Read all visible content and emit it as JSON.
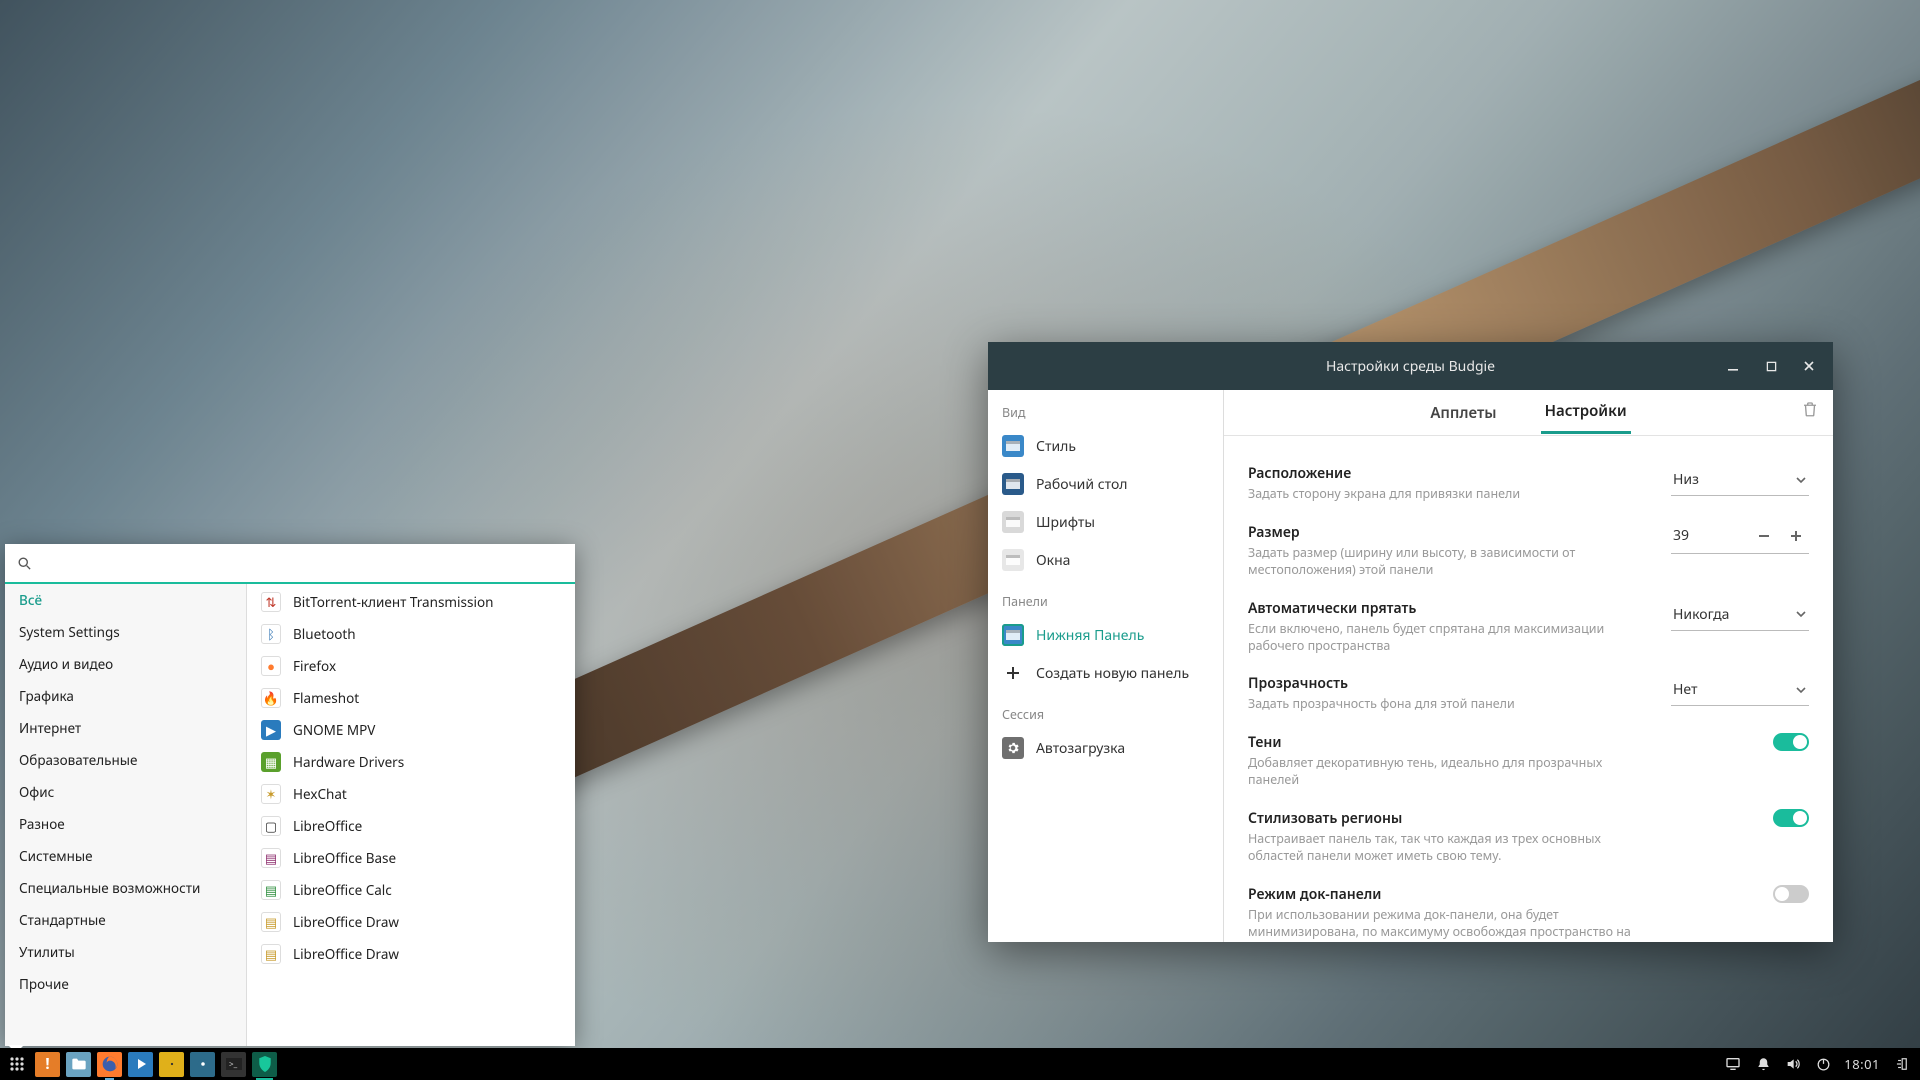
{
  "taskbar": {
    "clock": "18:01",
    "apps": [
      {
        "name": "menu-icon",
        "bg": "#000",
        "glyph": "grid",
        "running": false
      },
      {
        "name": "updates-icon",
        "bg": "#e57d28",
        "glyph": "!",
        "running": false
      },
      {
        "name": "files-icon",
        "bg": "#6aa3c1",
        "glyph": "folder",
        "running": false
      },
      {
        "name": "firefox-icon",
        "bg": "#ff7b2e",
        "glyph": "fx",
        "running": true
      },
      {
        "name": "video-icon",
        "bg": "#2a7bbd",
        "glyph": "play",
        "running": false
      },
      {
        "name": "music-icon",
        "bg": "#e0b01a",
        "glyph": "music",
        "running": false
      },
      {
        "name": "settings-icon",
        "bg": "#2d6b8a",
        "glyph": "gear",
        "running": false
      },
      {
        "name": "terminal-icon",
        "bg": "#333",
        "glyph": "term",
        "running": false
      },
      {
        "name": "shield-icon",
        "bg": "#0e5d48",
        "glyph": "shield",
        "running": false,
        "active": true
      }
    ]
  },
  "menu": {
    "search_placeholder": "",
    "categories": [
      "Всё",
      "System Settings",
      "Аудио и видео",
      "Графика",
      "Интернет",
      "Образовательные",
      "Офис",
      "Разное",
      "Системные",
      "Специальные возможности",
      "Стандартные",
      "Утилиты",
      "Прочие"
    ],
    "active_category": 0,
    "apps": [
      {
        "label": "BitTorrent-клиент Transmission",
        "bg": "#fff",
        "fg": "#c0392b",
        "glyph": "⇅"
      },
      {
        "label": "Bluetooth",
        "bg": "#fff",
        "fg": "#2a6fb0",
        "glyph": "ᛒ"
      },
      {
        "label": "Firefox",
        "bg": "#fff",
        "fg": "#ff7b2e",
        "glyph": "●"
      },
      {
        "label": "Flameshot",
        "bg": "#fff",
        "fg": "#7c3aed",
        "glyph": "🔥"
      },
      {
        "label": "GNOME MPV",
        "bg": "#2a7bbd",
        "fg": "#fff",
        "glyph": "▶"
      },
      {
        "label": "Hardware Drivers",
        "bg": "#5aa02c",
        "fg": "#fff",
        "glyph": "▦"
      },
      {
        "label": "HexChat",
        "bg": "#fff",
        "fg": "#c79a2a",
        "glyph": "✶"
      },
      {
        "label": "LibreOffice",
        "bg": "#fff",
        "fg": "#333",
        "glyph": "▢"
      },
      {
        "label": "LibreOffice Base",
        "bg": "#fff",
        "fg": "#8e2e6e",
        "glyph": "▤"
      },
      {
        "label": "LibreOffice Calc",
        "bg": "#fff",
        "fg": "#2e8e3e",
        "glyph": "▤"
      },
      {
        "label": "LibreOffice Draw",
        "bg": "#fff",
        "fg": "#c79a2a",
        "glyph": "▤"
      },
      {
        "label": "LibreOffice Draw",
        "bg": "#fff",
        "fg": "#c79a2a",
        "glyph": "▤"
      }
    ]
  },
  "settings_window": {
    "title": "Настройки среды Budgie",
    "sidebar": {
      "section_view": "Вид",
      "view_items": [
        {
          "label": "Стиль",
          "icon_bg": "#3a88c8"
        },
        {
          "label": "Рабочий стол",
          "icon_bg": "#2a5a8a"
        },
        {
          "label": "Шрифты",
          "icon_bg": "#d9d9d9"
        },
        {
          "label": "Окна",
          "icon_bg": "#e7e7e7"
        }
      ],
      "section_panels": "Панели",
      "panel_items": [
        {
          "label": "Нижняя Панель",
          "icon_bg": "#3a88c8",
          "active": true
        },
        {
          "label": "Создать новую панель",
          "icon_bg": "#fff",
          "plus": true
        }
      ],
      "section_session": "Сессия",
      "session_items": [
        {
          "label": "Автозагрузка",
          "icon_bg": "#6f6f6f"
        }
      ]
    },
    "tabs": {
      "applets": "Апплеты",
      "settings": "Настройки",
      "active": "settings"
    },
    "rows": {
      "position": {
        "title": "Расположение",
        "desc": "Задать сторону экрана для привязки панели",
        "value": "Низ"
      },
      "size": {
        "title": "Размер",
        "desc": "Задать размер (ширину или высоту, в зависимости от местоположения) этой панели",
        "value": "39"
      },
      "autohide": {
        "title": "Автоматически прятать",
        "desc": "Если включено, панель будет спрятана для максимизации рабочего пространства",
        "value": "Никогда"
      },
      "transparency": {
        "title": "Прозрачность",
        "desc": "Задать прозрачность фона для этой панели",
        "value": "Нет"
      },
      "shadows": {
        "title": "Тени",
        "desc": "Добавляет декоративную тень, идеально для прозрачных панелей",
        "on": true
      },
      "regions": {
        "title": "Стилизовать регионы",
        "desc": "Настраивает панель так, так что каждая из трех основных областей панели может иметь свою тему.",
        "on": true
      },
      "dock": {
        "title": "Режим док-панели",
        "desc": "При использовании режима док-панели, она будет минимизирована, по максимуму освобождая пространство на экране",
        "on": false
      }
    }
  }
}
